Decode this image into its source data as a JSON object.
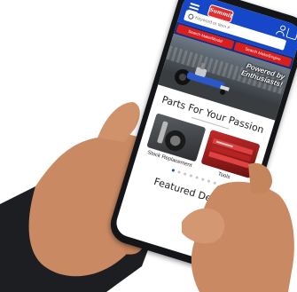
{
  "header": {
    "logo_text": "Summit",
    "search_placeholder": "Keyword or Item #"
  },
  "buttons": {
    "make_model": "Search Make/Model",
    "make_engine": "Search Make/Engine"
  },
  "hero": {
    "tagline": "Powered by Enthusiasts!"
  },
  "section": {
    "title": "Parts For Your Passion"
  },
  "categories": [
    {
      "label": "Stock Replacement"
    },
    {
      "label": "Tools"
    }
  ],
  "carousel": {
    "pages": 8,
    "active": 0
  },
  "featured": {
    "title": "Featured Deals"
  },
  "colors": {
    "header_blue": "#1647c8",
    "button_red": "#d71f1f",
    "skin": "#c98a63"
  }
}
